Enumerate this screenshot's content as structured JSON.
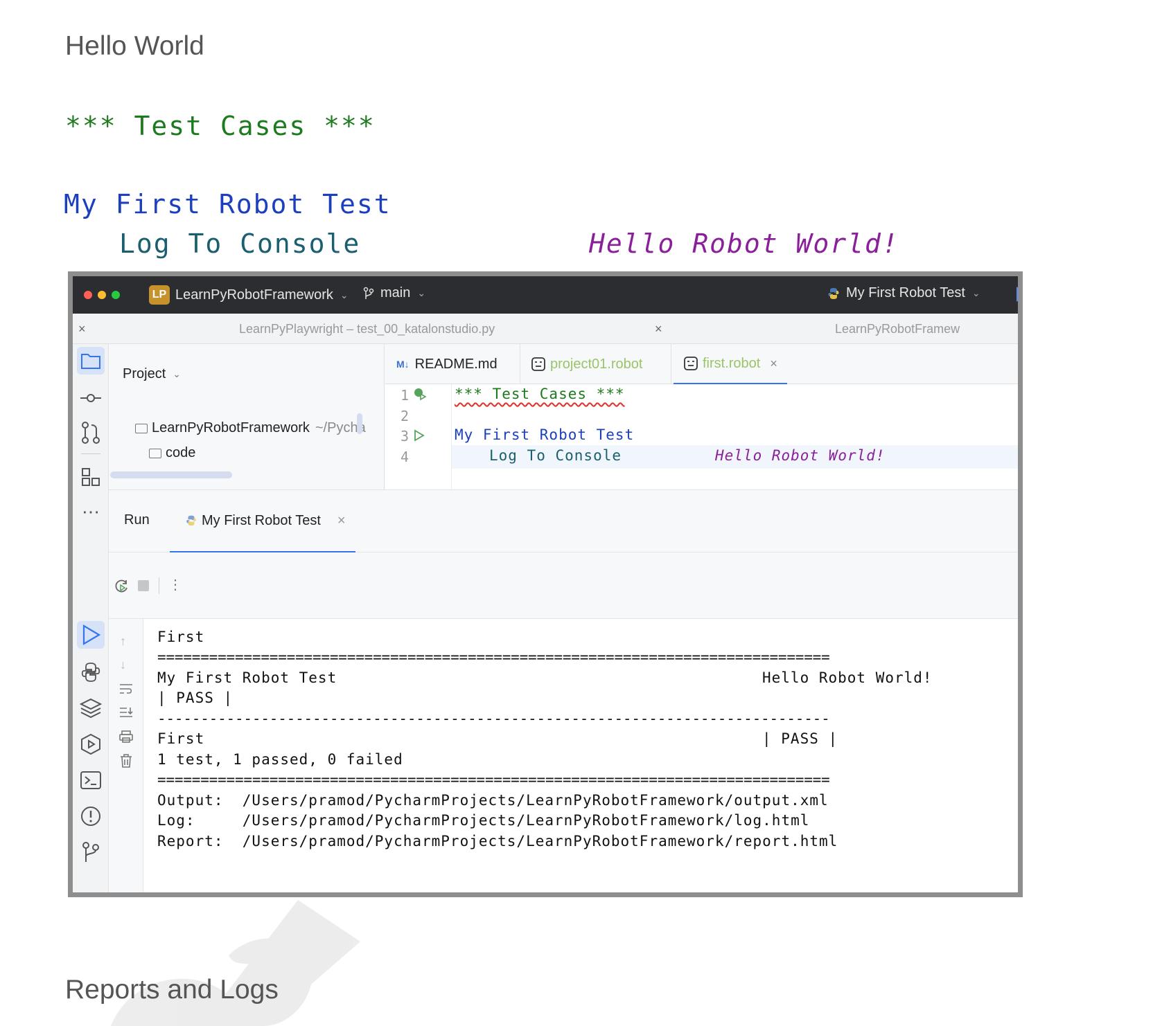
{
  "doc": {
    "title": "Hello World",
    "code_lines": [
      "*** Test Cases ***",
      "My First Robot Test",
      "Log To Console",
      "Hello Robot World!"
    ],
    "next_section": "Reports and Logs"
  },
  "ide": {
    "titlebar": {
      "project_badge": "LP",
      "project_name": "LearnPyRobotFramework",
      "branch": "main",
      "run_config": "My First Robot Test"
    },
    "window_tabs": [
      "LearnPyPlaywright – test_00_katalonstudio.py",
      "LearnPyRobotFramew"
    ],
    "project_pane": {
      "header": "Project",
      "root_name": "LearnPyRobotFramework",
      "root_path": "~/Pycha",
      "child": "code"
    },
    "editor_tabs": [
      {
        "label": "README.md",
        "badge": "M↓"
      },
      {
        "label": "project01.robot"
      },
      {
        "label": "first.robot"
      }
    ],
    "editor_lines": [
      {
        "num": "1",
        "text": "*** Test Cases ***"
      },
      {
        "num": "2",
        "text": ""
      },
      {
        "num": "3",
        "text": "My First Robot Test"
      },
      {
        "num": "4",
        "keyword": "Log To Console",
        "arg": "Hello Robot World!"
      }
    ],
    "run_panel": {
      "label": "Run",
      "tab": "My First Robot Test"
    },
    "console": {
      "lines": [
        "First",
        "==============================================================================",
        "My First Robot Test",
        "| PASS |",
        "------------------------------------------------------------------------------",
        "First",
        "1 test, 1 passed, 0 failed",
        "==============================================================================",
        "Output:  /Users/pramod/PycharmProjects/LearnPyRobotFramework/output.xml",
        "Log:     /Users/pramod/PycharmProjects/LearnPyRobotFramework/log.html",
        "Report:  /Users/pramod/PycharmProjects/LearnPyRobotFramework/report.html"
      ],
      "right_lines": [
        "Hello Robot World!",
        "| PASS |"
      ]
    }
  },
  "colors": {
    "keyword_green": "#1e7a1e",
    "testname_blue": "#1b3fbf",
    "keyword_teal": "#1a5f6f",
    "string_purple": "#8a1f9a",
    "accent_blue": "#3574f0"
  }
}
